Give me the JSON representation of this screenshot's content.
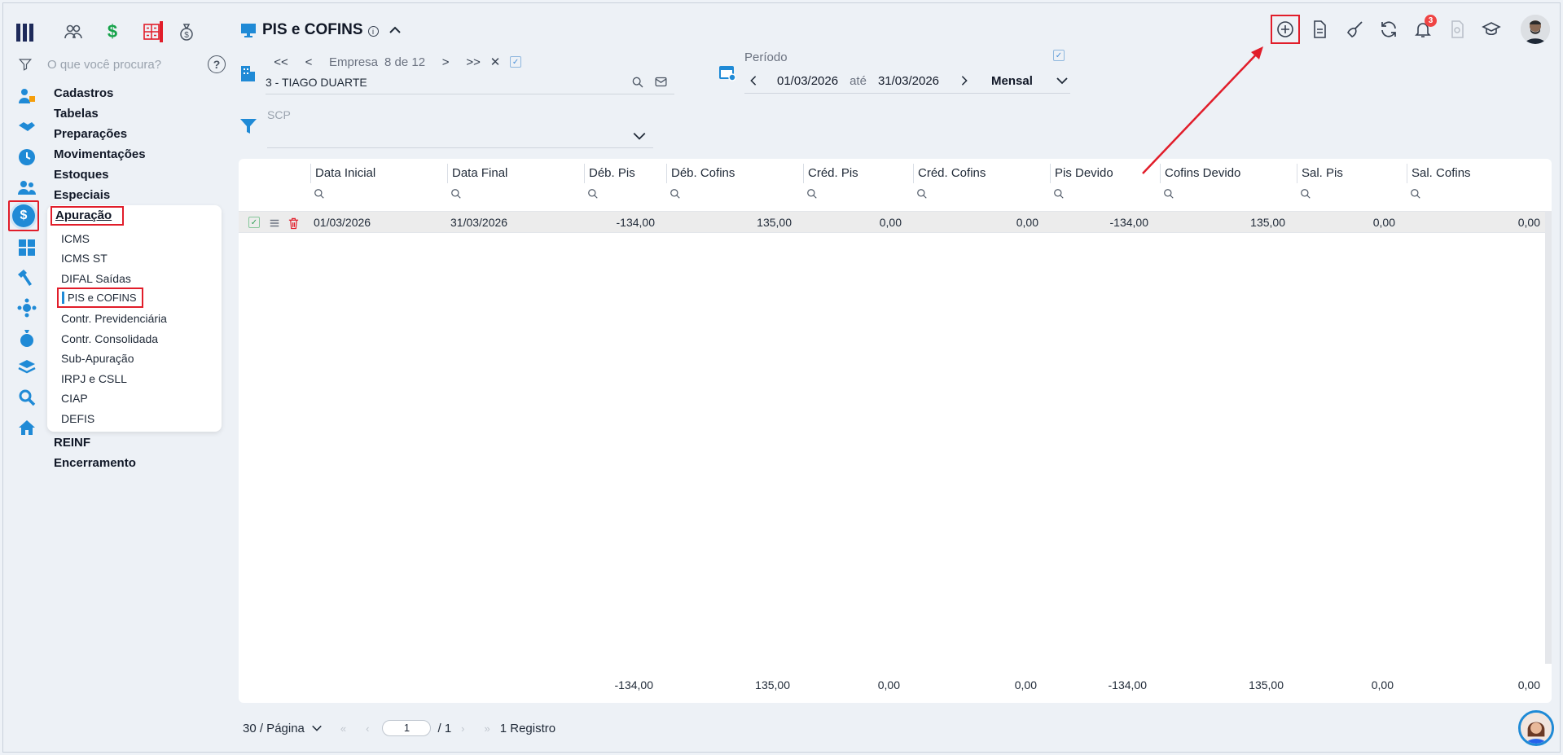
{
  "search": {
    "placeholder": "O que você procura?"
  },
  "menu": {
    "top_items": [
      "Cadastros",
      "Tabelas",
      "Preparações",
      "Movimentações",
      "Estoques",
      "Especiais"
    ],
    "active_section": "Apuração",
    "sub_items": [
      "ICMS",
      "ICMS ST",
      "DIFAL Saídas",
      "PIS e COFINS",
      "Contr. Previdenciária",
      "Contr. Consolidada",
      "Sub-Apuração",
      "IRPJ e CSLL",
      "CIAP",
      "DEFIS"
    ],
    "after_items": [
      "REINF",
      "Encerramento"
    ]
  },
  "page": {
    "title": "PIS e COFINS",
    "info": "i"
  },
  "toolbar": {
    "notification_count": "3"
  },
  "empresa": {
    "nav_label": "Empresa",
    "position": "8 de 12",
    "first": "<<",
    "prev": "<",
    "next": ">",
    "last": ">>",
    "clear": "✕",
    "value": "3 - TIAGO DUARTE"
  },
  "periodo": {
    "label": "Período",
    "start": "01/03/2026",
    "between": "até",
    "end": "31/03/2026",
    "mode": "Mensal"
  },
  "scp": {
    "label": "SCP"
  },
  "table": {
    "columns": [
      "Data Inicial",
      "Data Final",
      "Déb. Pis",
      "Déb. Cofins",
      "Créd. Pis",
      "Créd. Cofins",
      "Pis Devido",
      "Cofins Devido",
      "Sal. Pis",
      "Sal. Cofins"
    ],
    "rows": [
      [
        "01/03/2026",
        "31/03/2026",
        "-134,00",
        "135,00",
        "0,00",
        "0,00",
        "-134,00",
        "135,00",
        "0,00",
        "0,00"
      ]
    ],
    "totals": [
      "-134,00",
      "135,00",
      "0,00",
      "0,00",
      "-134,00",
      "135,00",
      "0,00",
      "0,00"
    ]
  },
  "pager": {
    "per_page": "30 / Página",
    "page": "1",
    "total_pages": "/ 1",
    "records": "1 Registro"
  }
}
